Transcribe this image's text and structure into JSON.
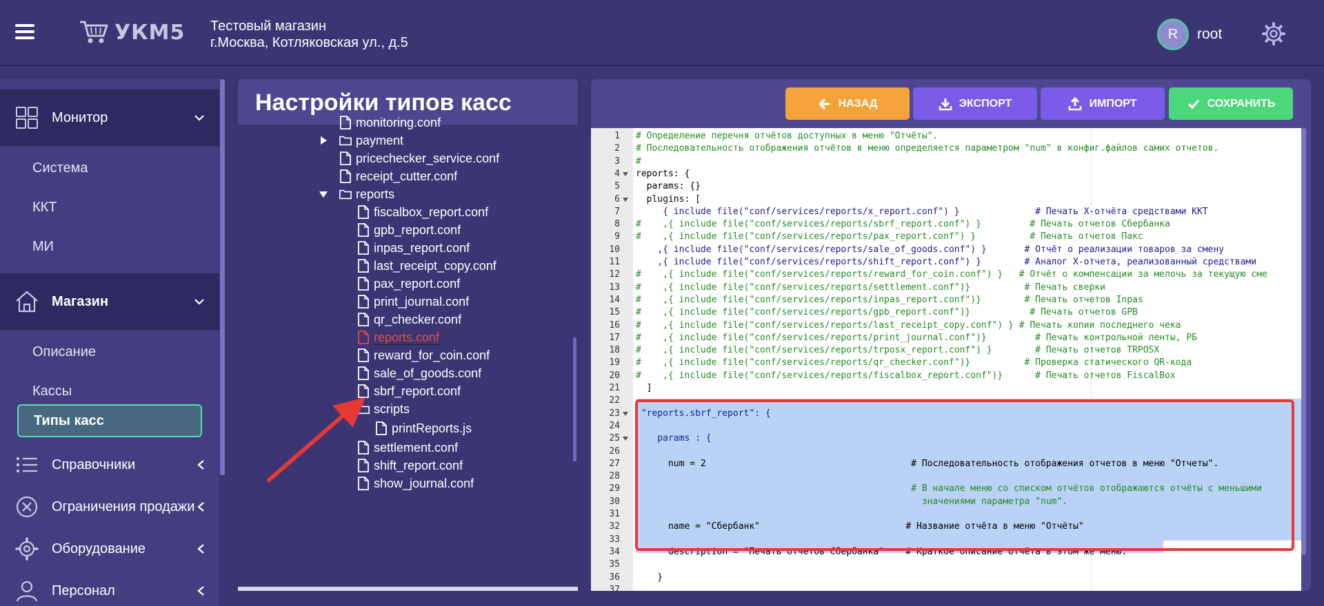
{
  "header": {
    "logo_text": "УКМ5",
    "store_name": "Тестовый магазин",
    "store_address": "г.Москва, Котляковская ул., д.5",
    "user_initial": "R",
    "username": "root"
  },
  "sidebar": {
    "monitor": {
      "label": "Монитор",
      "items": [
        "Система",
        "ККТ",
        "МИ"
      ]
    },
    "shop": {
      "label": "Магазин",
      "items": [
        "Описание",
        "Кассы",
        "Типы касс"
      ]
    },
    "sections": [
      "Справочники",
      "Ограничения продажи",
      "Оборудование",
      "Персонал"
    ]
  },
  "tree": {
    "title": "Настройки типов касс",
    "items": [
      "monitoring.conf",
      "payment",
      "pricechecker_service.conf",
      "receipt_cutter.conf",
      "reports",
      "fiscalbox_report.conf",
      "gpb_report.conf",
      "inpas_report.conf",
      "last_receipt_copy.conf",
      "pax_report.conf",
      "print_journal.conf",
      "qr_checker.conf",
      "reports.conf",
      "reward_for_coin.conf",
      "sale_of_goods.conf",
      "sbrf_report.conf",
      "scripts",
      "printReports.js",
      "settlement.conf",
      "shift_report.conf",
      "show_journal.conf"
    ]
  },
  "toolbar": {
    "back": "НАЗАД",
    "export": "ЭКСПОРТ",
    "import": "ИМПОРТ",
    "save": "СОХРАНИТЬ"
  },
  "code_lines": [
    "# Определение перечня отчётов доступных в меню \"Отчёты\".",
    "# Последовательность отображения отчётов в меню определяется параметром \"num\" в конфиг.файлов самих отчетов.",
    "#",
    "reports: {",
    "  params: {}",
    "  plugins: [",
    "     { include file(\"conf/services/reports/x_report.conf\") }              # Печать X-отчёта средствами ККТ",
    "#    ,{ include file(\"conf/services/reports/sbrf_report.conf\") }         # Печать отчетов Сбербанка",
    "#    ,{ include file(\"conf/services/reports/pax_report.conf\") }          # Печать отчетов Пакс",
    "    ,{ include file(\"conf/services/reports/sale_of_goods.conf\") }       # Отчёт о реализации товаров за смену",
    "    ,{ include file(\"conf/services/reports/shift_report.conf\") }        # Аналог X-отчета, реализованный средствами",
    "#    ,{ include file(\"conf/services/reports/reward_for_coin.conf\") }   # Отчёт о компенсации за мелочь за текущую сме",
    "#    ,{ include file(\"conf/services/reports/settlement.conf\")}          # Печать сверки",
    "#    ,{ include file(\"conf/services/reports/inpas_report.conf\")}        # Печать отчетов Inpas",
    "#    ,{ include file(\"conf/services/reports/gpb_report.conf\")}           # Печать отчетов GPB",
    "#    ,{ include file(\"conf/services/reports/last_receipt_copy.conf\") } # Печать копии последнего чека",
    "#    ,{ include file(\"conf/services/reports/print_journal.conf\")}         # Печать контрольной ленты, РБ",
    "#    ,{ include file(\"conf/services/reports/trposx_report.conf\") }        # Печать отчетов TRPOSX",
    "#    ,{ include file(\"conf/services/reports/qr_checker.conf\")}          # Проверка статического QR-кода",
    "#    ,{ include file(\"conf/services/reports/fiscalbox_report.conf\")}      # Печать отчетов FiscalBox",
    "  ]",
    "",
    " \"reports.sbrf_report\": {",
    "",
    "    params : {",
    "",
    "      num = 2                                      # Последовательность отображения отчетов в меню \"Отчеты\".",
    "",
    "                                                   # В начале меню со списком отчётов отображаются отчёты с меньшими",
    "                                                     значениями параметра \"num\".",
    "",
    "      name = \"Сбербанк\"                           # Название отчёта в меню \"Отчёты\"",
    "",
    "      description = \"Печать отчетов Сбербанка\"    # Краткое описание отчёта в этом же меню.",
    "",
    "    }",
    "",
    ""
  ],
  "code_kinds": [
    "com",
    "com",
    "com",
    "txt",
    "txt",
    "txt",
    "key",
    "com",
    "com",
    "key",
    "key",
    "com",
    "com",
    "com",
    "com",
    "com",
    "com",
    "com",
    "com",
    "com",
    "txt",
    "txt",
    "key",
    "txt",
    "key",
    "txt",
    "mix",
    "txt",
    "com",
    "com",
    "txt",
    "mix",
    "txt",
    "mix",
    "txt",
    "txt",
    "txt",
    "txt"
  ],
  "colors": {
    "accent_green": "#53e0b1",
    "back_button": "#f4a33a",
    "export_import_button": "#7a5ce8",
    "save_button": "#4cd77b",
    "selection_frame": "#e53935"
  }
}
